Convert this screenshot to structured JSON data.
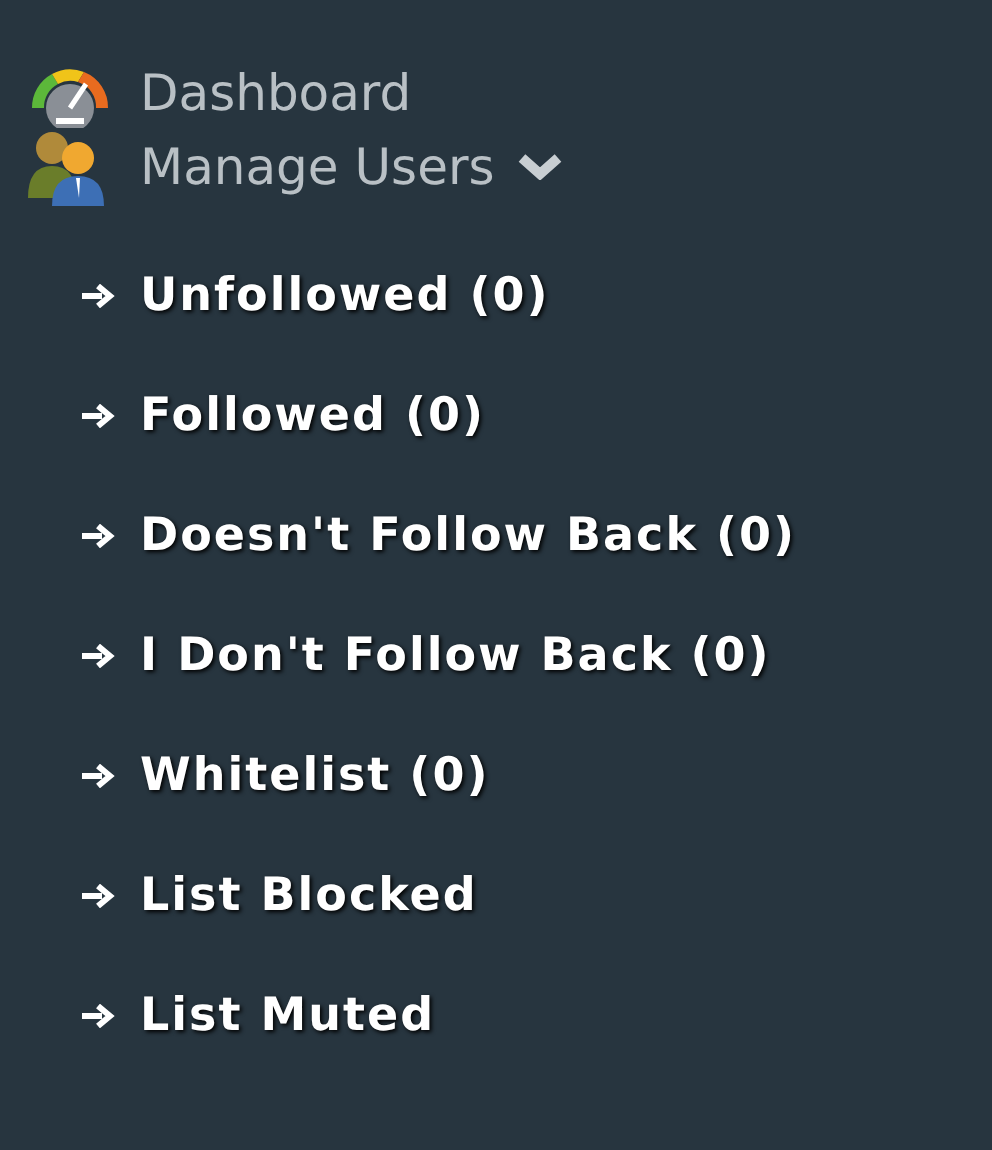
{
  "menu": [
    {
      "kind": "dashboard",
      "label": "Dashboard"
    },
    {
      "kind": "users",
      "label": "Manage Users",
      "expanded": true,
      "children": [
        {
          "label": "Unfollowed (0)"
        },
        {
          "label": "Followed (0)"
        },
        {
          "label": "Doesn't Follow Back (0)"
        },
        {
          "label": "I Don't Follow Back (0)"
        },
        {
          "label": "Whitelist (0)"
        },
        {
          "label": "List Blocked"
        },
        {
          "label": "List Muted"
        }
      ]
    }
  ]
}
